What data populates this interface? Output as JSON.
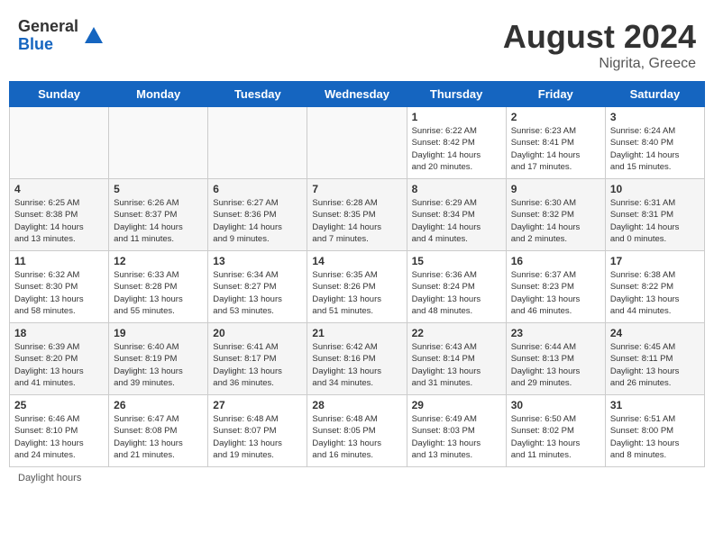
{
  "header": {
    "logo_general": "General",
    "logo_blue": "Blue",
    "month_year": "August 2024",
    "location": "Nigrita, Greece"
  },
  "footer": {
    "daylight_label": "Daylight hours"
  },
  "weekdays": [
    "Sunday",
    "Monday",
    "Tuesday",
    "Wednesday",
    "Thursday",
    "Friday",
    "Saturday"
  ],
  "weeks": [
    [
      {
        "day": "",
        "info": ""
      },
      {
        "day": "",
        "info": ""
      },
      {
        "day": "",
        "info": ""
      },
      {
        "day": "",
        "info": ""
      },
      {
        "day": "1",
        "info": "Sunrise: 6:22 AM\nSunset: 8:42 PM\nDaylight: 14 hours\nand 20 minutes."
      },
      {
        "day": "2",
        "info": "Sunrise: 6:23 AM\nSunset: 8:41 PM\nDaylight: 14 hours\nand 17 minutes."
      },
      {
        "day": "3",
        "info": "Sunrise: 6:24 AM\nSunset: 8:40 PM\nDaylight: 14 hours\nand 15 minutes."
      }
    ],
    [
      {
        "day": "4",
        "info": "Sunrise: 6:25 AM\nSunset: 8:38 PM\nDaylight: 14 hours\nand 13 minutes."
      },
      {
        "day": "5",
        "info": "Sunrise: 6:26 AM\nSunset: 8:37 PM\nDaylight: 14 hours\nand 11 minutes."
      },
      {
        "day": "6",
        "info": "Sunrise: 6:27 AM\nSunset: 8:36 PM\nDaylight: 14 hours\nand 9 minutes."
      },
      {
        "day": "7",
        "info": "Sunrise: 6:28 AM\nSunset: 8:35 PM\nDaylight: 14 hours\nand 7 minutes."
      },
      {
        "day": "8",
        "info": "Sunrise: 6:29 AM\nSunset: 8:34 PM\nDaylight: 14 hours\nand 4 minutes."
      },
      {
        "day": "9",
        "info": "Sunrise: 6:30 AM\nSunset: 8:32 PM\nDaylight: 14 hours\nand 2 minutes."
      },
      {
        "day": "10",
        "info": "Sunrise: 6:31 AM\nSunset: 8:31 PM\nDaylight: 14 hours\nand 0 minutes."
      }
    ],
    [
      {
        "day": "11",
        "info": "Sunrise: 6:32 AM\nSunset: 8:30 PM\nDaylight: 13 hours\nand 58 minutes."
      },
      {
        "day": "12",
        "info": "Sunrise: 6:33 AM\nSunset: 8:28 PM\nDaylight: 13 hours\nand 55 minutes."
      },
      {
        "day": "13",
        "info": "Sunrise: 6:34 AM\nSunset: 8:27 PM\nDaylight: 13 hours\nand 53 minutes."
      },
      {
        "day": "14",
        "info": "Sunrise: 6:35 AM\nSunset: 8:26 PM\nDaylight: 13 hours\nand 51 minutes."
      },
      {
        "day": "15",
        "info": "Sunrise: 6:36 AM\nSunset: 8:24 PM\nDaylight: 13 hours\nand 48 minutes."
      },
      {
        "day": "16",
        "info": "Sunrise: 6:37 AM\nSunset: 8:23 PM\nDaylight: 13 hours\nand 46 minutes."
      },
      {
        "day": "17",
        "info": "Sunrise: 6:38 AM\nSunset: 8:22 PM\nDaylight: 13 hours\nand 44 minutes."
      }
    ],
    [
      {
        "day": "18",
        "info": "Sunrise: 6:39 AM\nSunset: 8:20 PM\nDaylight: 13 hours\nand 41 minutes."
      },
      {
        "day": "19",
        "info": "Sunrise: 6:40 AM\nSunset: 8:19 PM\nDaylight: 13 hours\nand 39 minutes."
      },
      {
        "day": "20",
        "info": "Sunrise: 6:41 AM\nSunset: 8:17 PM\nDaylight: 13 hours\nand 36 minutes."
      },
      {
        "day": "21",
        "info": "Sunrise: 6:42 AM\nSunset: 8:16 PM\nDaylight: 13 hours\nand 34 minutes."
      },
      {
        "day": "22",
        "info": "Sunrise: 6:43 AM\nSunset: 8:14 PM\nDaylight: 13 hours\nand 31 minutes."
      },
      {
        "day": "23",
        "info": "Sunrise: 6:44 AM\nSunset: 8:13 PM\nDaylight: 13 hours\nand 29 minutes."
      },
      {
        "day": "24",
        "info": "Sunrise: 6:45 AM\nSunset: 8:11 PM\nDaylight: 13 hours\nand 26 minutes."
      }
    ],
    [
      {
        "day": "25",
        "info": "Sunrise: 6:46 AM\nSunset: 8:10 PM\nDaylight: 13 hours\nand 24 minutes."
      },
      {
        "day": "26",
        "info": "Sunrise: 6:47 AM\nSunset: 8:08 PM\nDaylight: 13 hours\nand 21 minutes."
      },
      {
        "day": "27",
        "info": "Sunrise: 6:48 AM\nSunset: 8:07 PM\nDaylight: 13 hours\nand 19 minutes."
      },
      {
        "day": "28",
        "info": "Sunrise: 6:48 AM\nSunset: 8:05 PM\nDaylight: 13 hours\nand 16 minutes."
      },
      {
        "day": "29",
        "info": "Sunrise: 6:49 AM\nSunset: 8:03 PM\nDaylight: 13 hours\nand 13 minutes."
      },
      {
        "day": "30",
        "info": "Sunrise: 6:50 AM\nSunset: 8:02 PM\nDaylight: 13 hours\nand 11 minutes."
      },
      {
        "day": "31",
        "info": "Sunrise: 6:51 AM\nSunset: 8:00 PM\nDaylight: 13 hours\nand 8 minutes."
      }
    ]
  ]
}
